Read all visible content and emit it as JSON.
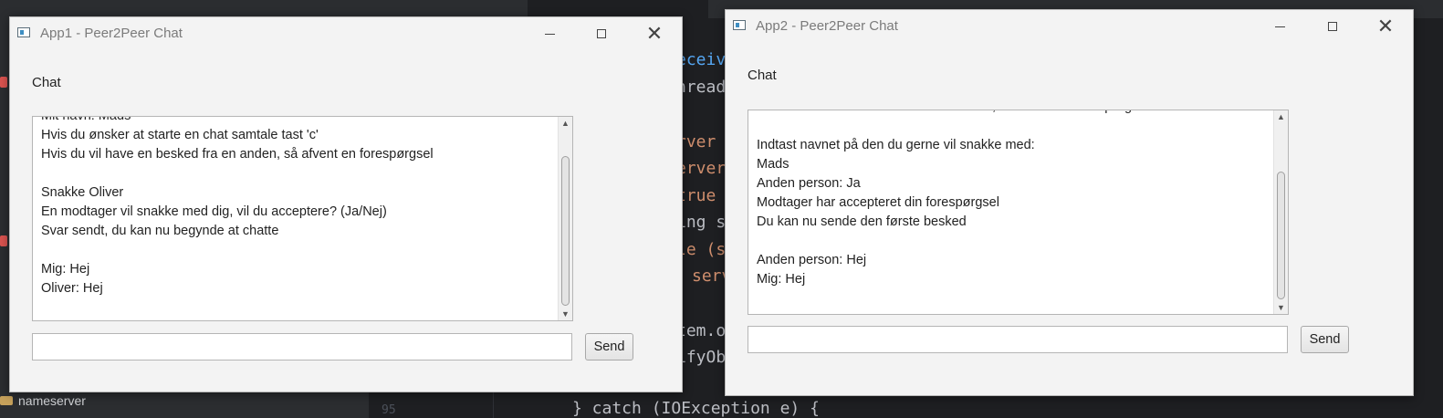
{
  "ide": {
    "tree_item": "nameserver",
    "line_number": "95",
    "code_lines": [
      {
        "text": "eceiv",
        "class": "fn"
      },
      {
        "text": "hread",
        "class": ""
      },
      {
        "text": "rver",
        "class": "kw"
      },
      {
        "text": "erver",
        "class": "kw"
      },
      {
        "text": "true",
        "class": "kw"
      },
      {
        "text": "ing s",
        "class": ""
      },
      {
        "text": "le (s",
        "class": "kw"
      },
      {
        "text": "serv",
        "class": "kw"
      },
      {
        "text": "tem.o",
        "class": ""
      },
      {
        "text": "ifyOb",
        "class": ""
      },
      {
        "text": "} catch (IOException e) {",
        "class": ""
      }
    ]
  },
  "app1": {
    "title": "App1 - Peer2Peer Chat",
    "chat_label": "Chat",
    "lines": [
      "Mit navn: Mads",
      "Hvis du ønsker at starte en chat samtale tast 'c'",
      "Hvis du vil have en besked fra en anden, så afvent en forespørgsel",
      "",
      "Snakke Oliver",
      "En modtager vil snakke med dig, vil du acceptere? (Ja/Nej)",
      "Svar sendt, du kan nu begynde at chatte",
      "",
      "Mig: Hej",
      "Oliver: Hej"
    ],
    "input_value": "",
    "send_label": "Send"
  },
  "app2": {
    "title": "App2 - Peer2Peer Chat",
    "chat_label": "Chat",
    "lines": [
      "Hvis du vil have en besked fra en anden, så afvent en forespørgsel",
      "",
      "Indtast navnet på den du gerne vil snakke med:",
      "Mads",
      "Anden person: Ja",
      "Modtager har accepteret din forespørgsel",
      "Du kan nu sende den første besked",
      "",
      "Anden person: Hej",
      "Mig: Hej"
    ],
    "input_value": "",
    "send_label": "Send"
  },
  "window_controls": {
    "minimize": "—",
    "maximize": "☐",
    "close": "✕"
  },
  "icons": {
    "app": "app-window-icon",
    "scroll_up": "▲",
    "scroll_down": "▼"
  }
}
